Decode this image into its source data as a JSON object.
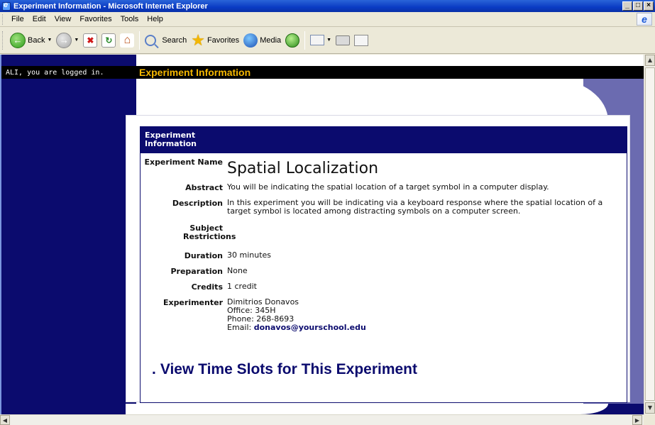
{
  "window": {
    "title": "Experiment Information - Microsoft Internet Explorer",
    "buttons": [
      "_",
      "□",
      "×"
    ]
  },
  "menu": [
    "File",
    "Edit",
    "View",
    "Favorites",
    "Tools",
    "Help"
  ],
  "toolbar": {
    "back": "Back",
    "search": "Search",
    "favorites": "Favorites",
    "media": "Media"
  },
  "page": {
    "logged_in": "ALI, you are logged in.",
    "heading": "Experiment Information",
    "table_header": "Experiment Information",
    "rows": [
      {
        "label": "Experiment Name",
        "value": "Spatial Localization"
      },
      {
        "label": "Abstract",
        "value": "You will be indicating the spatial location of a target symbol in a computer display."
      },
      {
        "label": "Description",
        "value": "In this experiment you will be indicating via a keyboard response where the spatial location of a target symbol is located among distracting symbols on a computer screen."
      },
      {
        "label": "Subject Restrictions",
        "value": ""
      },
      {
        "label": "Duration",
        "value": "30 minutes"
      },
      {
        "label": "Preparation",
        "value": "None"
      },
      {
        "label": "Credits",
        "value": "1 credit"
      },
      {
        "label": "Experimenter",
        "value": "Dimitrios Donavos"
      }
    ],
    "experimenter_details": {
      "office": "Office: 345H",
      "phone": "Phone: 268-8693",
      "email_label": "Email: ",
      "email": "donavos@yourschool.edu"
    },
    "view_slots_bullet": ".",
    "view_slots": "View Time Slots for This Experiment"
  },
  "colors": {
    "nav_bg": "#0b0b6e",
    "heading": "#f6b800",
    "deco": "#6b6bb0"
  }
}
